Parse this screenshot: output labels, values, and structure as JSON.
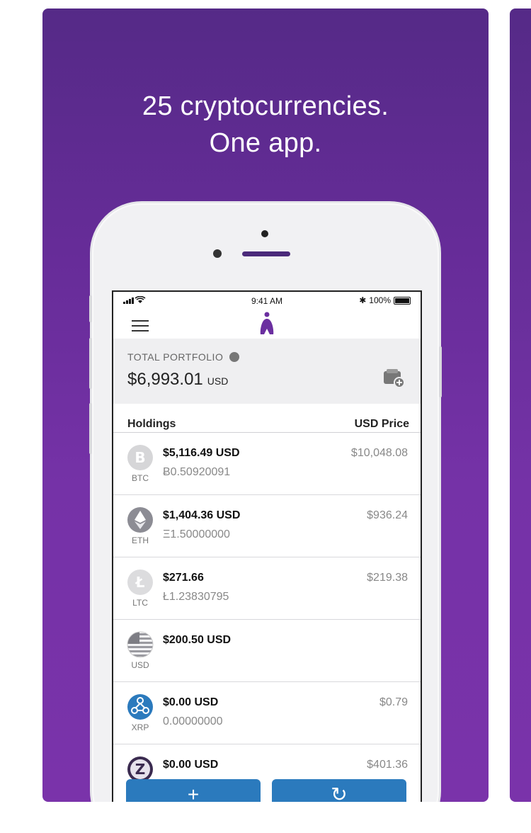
{
  "headline": {
    "line1": "25 cryptocurrencies.",
    "line2": "One app."
  },
  "statusbar": {
    "signal": "•ıl",
    "time": "9:41 AM",
    "battery_text": "100%"
  },
  "portfolio": {
    "label": "TOTAL PORTFOLIO",
    "value": "$6,993.01",
    "unit": "USD"
  },
  "holdings": {
    "header_left": "Holdings",
    "header_right": "USD Price",
    "rows": [
      {
        "code": "BTC",
        "amount": "$5,116.49 USD",
        "quantity": "Ƀ0.50920091",
        "price": "$10,048.08"
      },
      {
        "code": "ETH",
        "amount": "$1,404.36 USD",
        "quantity": "Ξ1.50000000",
        "price": "$936.24"
      },
      {
        "code": "LTC",
        "amount": "$271.66",
        "quantity": "Ł1.23830795",
        "price": "$219.38"
      },
      {
        "code": "USD",
        "amount": "$200.50 USD",
        "quantity": "",
        "price": ""
      },
      {
        "code": "XRP",
        "amount": "$0.00 USD",
        "quantity": "0.00000000",
        "price": "$0.79"
      },
      {
        "code": "",
        "amount": "$0.00 USD",
        "quantity": "",
        "price": "$401.36"
      }
    ]
  },
  "buttons": {
    "add": "+",
    "refresh": "↻"
  },
  "colors": {
    "brand_purple": "#6b2fa0",
    "action_blue": "#2b7abd"
  }
}
